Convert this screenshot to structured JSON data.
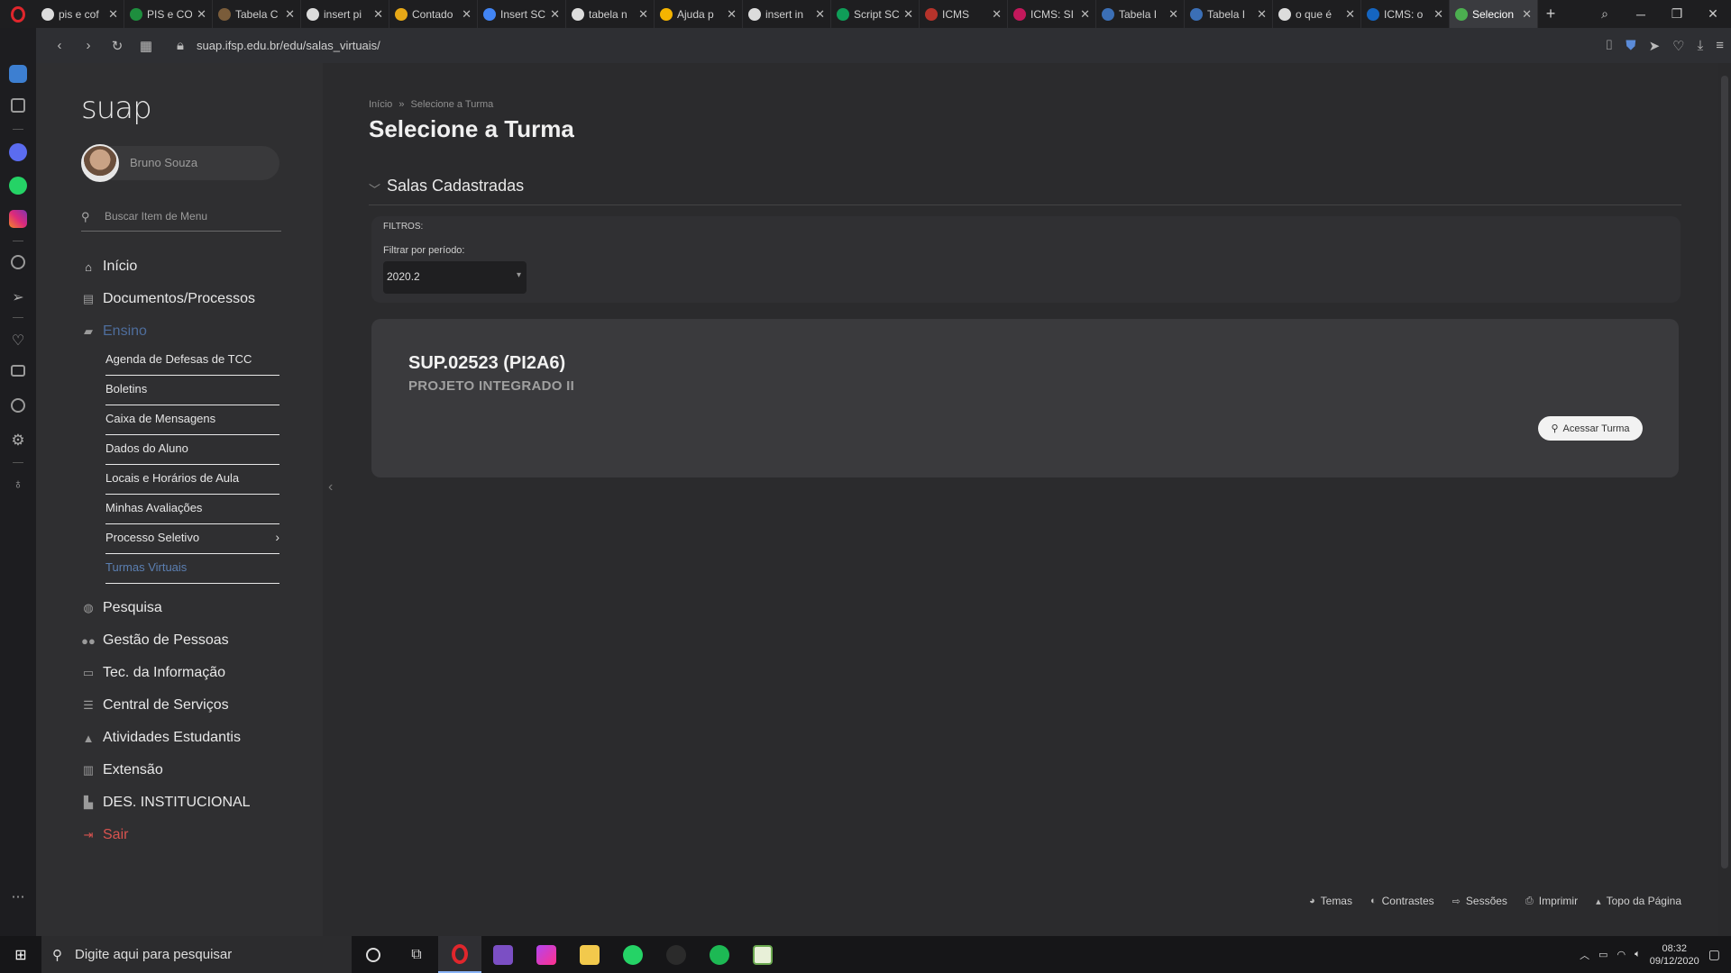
{
  "browser": {
    "tabs": [
      {
        "label": "pis e cof",
        "fav": "#dcdcdc"
      },
      {
        "label": "PIS e CO",
        "fav": "#1e8e3e"
      },
      {
        "label": "Tabela C",
        "fav": "#7a5c3a"
      },
      {
        "label": "insert pi",
        "fav": "#dcdcdc"
      },
      {
        "label": "Contado",
        "fav": "#e6a817"
      },
      {
        "label": "Insert SC",
        "fav": "#4285f4"
      },
      {
        "label": "tabela n",
        "fav": "#dcdcdc"
      },
      {
        "label": "Ajuda p",
        "fav": "#f4b400"
      },
      {
        "label": "insert in",
        "fav": "#dcdcdc"
      },
      {
        "label": "Script SC",
        "fav": "#0f9d58"
      },
      {
        "label": "ICMS",
        "fav": "#b5332b"
      },
      {
        "label": "ICMS: SI",
        "fav": "#c2185b"
      },
      {
        "label": "Tabela I",
        "fav": "#3b6fb6"
      },
      {
        "label": "Tabela I",
        "fav": "#3b6fb6"
      },
      {
        "label": "o que é",
        "fav": "#dcdcdc"
      },
      {
        "label": "ICMS: o",
        "fav": "#1565c0"
      },
      {
        "label": "Selecion",
        "fav": "#4caf50"
      }
    ],
    "url": "suap.ifsp.edu.br/edu/salas_virtuais/"
  },
  "sidebar": {
    "logo": "suap",
    "user_name": "Bruno Souza",
    "search_placeholder": "Buscar Item de Menu",
    "items": [
      {
        "label": "Início",
        "icon": "home-icon"
      },
      {
        "label": "Documentos/Processos",
        "icon": "document-icon"
      },
      {
        "label": "Ensino",
        "icon": "graduation-icon"
      },
      {
        "label": "Pesquisa",
        "icon": "globe-icon"
      },
      {
        "label": "Gestão de Pessoas",
        "icon": "people-icon"
      },
      {
        "label": "Tec. da Informação",
        "icon": "laptop-icon"
      },
      {
        "label": "Central de Serviços",
        "icon": "list-icon"
      },
      {
        "label": "Atividades Estudantis",
        "icon": "cap-icon"
      },
      {
        "label": "Extensão",
        "icon": "building-icon"
      },
      {
        "label": "DES. INSTITUCIONAL",
        "icon": "chart-icon"
      },
      {
        "label": "Sair",
        "icon": "logout-icon"
      }
    ],
    "ensino_subitems": [
      "Agenda de Defesas de TCC",
      "Boletins",
      "Caixa de Mensagens",
      "Dados do Aluno",
      "Locais e Horários de Aula",
      "Minhas Avaliações",
      "Processo Seletivo",
      "Turmas Virtuais"
    ]
  },
  "main": {
    "breadcrumb": {
      "home": "Início",
      "sep": "»",
      "current": "Selecione a Turma"
    },
    "title": "Selecione a Turma",
    "section_title": "Salas Cadastradas",
    "filters": {
      "label": "FILTROS:",
      "period_label": "Filtrar por período:",
      "period_value": "2020.2"
    },
    "class": {
      "code": "SUP.02523 (PI2A6)",
      "name": "PROJETO INTEGRADO II",
      "button": "Acessar Turma"
    },
    "footer_links": [
      "Temas",
      "Contrastes",
      "Sessões",
      "Imprimir",
      "Topo da Página"
    ]
  },
  "taskbar": {
    "search_placeholder": "Digite aqui para pesquisar",
    "time": "08:32",
    "date": "09/12/2020"
  }
}
